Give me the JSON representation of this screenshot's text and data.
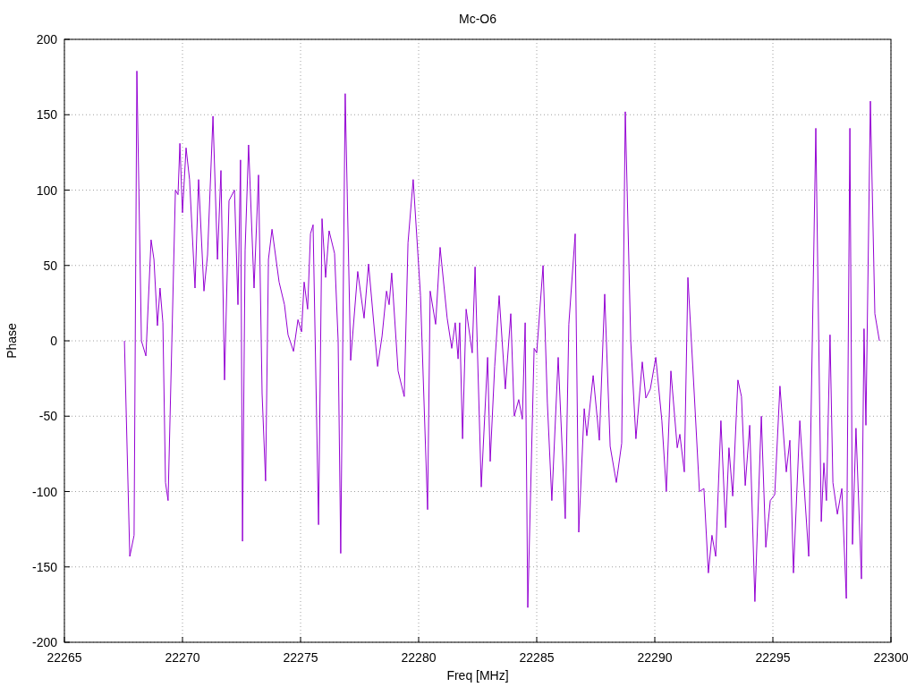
{
  "chart_data": {
    "type": "line",
    "grid": true,
    "title": "Mc-O6",
    "xlabel": "Freq [MHz]",
    "ylabel": "Phase",
    "xlim": [
      22265,
      22300
    ],
    "ylim": [
      -200,
      200
    ],
    "xticks": [
      22265,
      22270,
      22275,
      22280,
      22285,
      22290,
      22295,
      22300
    ],
    "yticks": [
      -200,
      -150,
      -100,
      -50,
      0,
      50,
      100,
      150,
      200
    ],
    "x": [
      22267.54,
      22267.77,
      22267.95,
      22268.07,
      22268.26,
      22268.45,
      22268.67,
      22268.79,
      22268.94,
      22269.05,
      22269.17,
      22269.28,
      22269.39,
      22269.7,
      22269.81,
      22269.89,
      22270.0,
      22270.15,
      22270.3,
      22270.53,
      22270.68,
      22270.91,
      22271.06,
      22271.29,
      22271.48,
      22271.63,
      22271.78,
      22271.97,
      22272.2,
      22272.35,
      22272.46,
      22272.54,
      22272.65,
      22272.8,
      22273.03,
      22273.22,
      22273.37,
      22273.52,
      22273.64,
      22273.79,
      22274.09,
      22274.32,
      22274.47,
      22274.7,
      22274.89,
      22275.04,
      22275.15,
      22275.3,
      22275.42,
      22275.53,
      22275.76,
      22275.91,
      22276.06,
      22276.21,
      22276.44,
      22276.59,
      22276.7,
      22276.89,
      22277.12,
      22277.42,
      22277.69,
      22277.88,
      22278.26,
      22278.45,
      22278.64,
      22278.75,
      22278.86,
      22279.13,
      22279.39,
      22279.55,
      22279.77,
      22280.08,
      22280.38,
      22280.49,
      22280.72,
      22280.91,
      22281.21,
      22281.4,
      22281.55,
      22281.67,
      22281.74,
      22281.86,
      22282.01,
      22282.27,
      22282.39,
      22282.65,
      22282.92,
      22283.03,
      22283.22,
      22283.41,
      22283.67,
      22283.9,
      22284.05,
      22284.24,
      22284.39,
      22284.51,
      22284.62,
      22284.89,
      22285.0,
      22285.27,
      22285.45,
      22285.64,
      22285.91,
      22286.21,
      22286.36,
      22286.63,
      22286.78,
      22287.01,
      22287.12,
      22287.39,
      22287.65,
      22287.88,
      22288.11,
      22288.37,
      22288.6,
      22288.75,
      22288.98,
      22289.2,
      22289.47,
      22289.62,
      22289.81,
      22290.04,
      22290.3,
      22290.49,
      22290.68,
      22290.95,
      22291.06,
      22291.25,
      22291.4,
      22291.67,
      22291.89,
      22292.08,
      22292.27,
      22292.42,
      22292.58,
      22292.8,
      22293.0,
      22293.14,
      22293.3,
      22293.52,
      22293.67,
      22293.83,
      22294.02,
      22294.24,
      22294.51,
      22294.7,
      22294.89,
      22295.08,
      22295.3,
      22295.57,
      22295.72,
      22295.87,
      22296.14,
      22296.52,
      22296.82,
      22297.05,
      22297.16,
      22297.27,
      22297.42,
      22297.54,
      22297.73,
      22297.92,
      22298.11,
      22298.26,
      22298.37,
      22298.52,
      22298.75,
      22298.86,
      22298.94,
      22299.13,
      22299.32,
      22299.51
    ],
    "series": [
      {
        "color": "#9400d3",
        "values": [
          0,
          -143,
          -129,
          179,
          0,
          -10,
          67,
          54,
          10,
          35,
          12,
          -94,
          -106,
          100,
          97,
          131,
          85,
          128,
          107,
          35,
          107,
          33,
          57,
          149,
          54,
          113,
          -26,
          93,
          100,
          24,
          120,
          -133,
          60,
          130,
          35,
          110,
          -35,
          -93,
          54,
          74,
          39,
          24,
          4,
          -7,
          14,
          6,
          39,
          21,
          71,
          77,
          -122,
          81,
          42,
          73,
          58,
          0,
          -141,
          164,
          -13,
          46,
          15,
          51,
          -17,
          3,
          33,
          24,
          45,
          -20,
          -37,
          65,
          107,
          30,
          -112,
          33,
          11,
          62,
          15,
          -5,
          12,
          -12,
          12,
          -65,
          21,
          -8,
          49,
          -97,
          -11,
          -80,
          -17,
          30,
          -32,
          18,
          -50,
          -39,
          -52,
          12,
          -177,
          -5,
          -8,
          50,
          -41,
          -106,
          -11,
          -118,
          11,
          71,
          -127,
          -45,
          -63,
          -23,
          -66,
          31,
          -70,
          -94,
          -68,
          152,
          0,
          -65,
          -14,
          -38,
          -32,
          -11,
          -53,
          -100,
          -20,
          -71,
          -62,
          -87,
          42,
          -35,
          -100,
          -98,
          -154,
          -129,
          -143,
          -53,
          -124,
          -71,
          -103,
          -26,
          -37,
          -96,
          -56,
          -173,
          -50,
          -137,
          -106,
          -102,
          -30,
          -87,
          -66,
          -154,
          -53,
          -143,
          141,
          -120,
          -81,
          -106,
          4,
          -94,
          -115,
          -98,
          -171,
          141,
          -135,
          -58,
          -158,
          8,
          -56,
          159,
          18,
          0
        ]
      }
    ]
  }
}
